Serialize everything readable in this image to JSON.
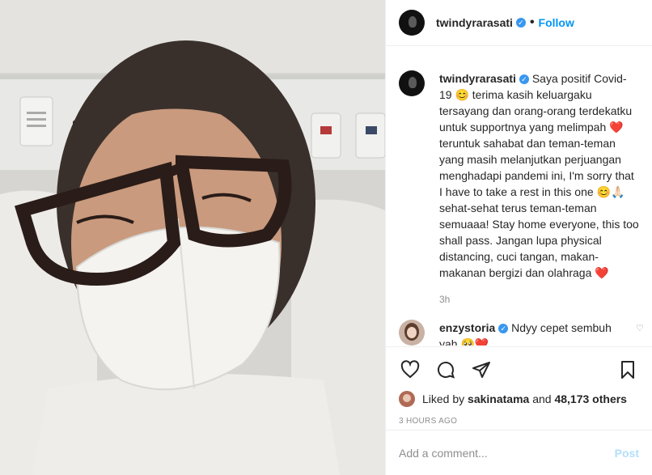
{
  "post": {
    "username": "twindyrarasati",
    "follow_label": "Follow",
    "separator": "•"
  },
  "caption": {
    "username": "twindyrarasati",
    "text": "Saya positif Covid-19 😊 terima kasih keluargaku tersayang dan orang-orang terdekatku untuk supportnya yang melimpah ❤️ teruntuk sahabat dan teman-teman yang masih melanjutkan perjuangan menghadapi pandemi ini, I'm sorry that I have to take a rest in this one 😊🙏🏻 sehat-sehat terus teman-teman semuaaa! Stay home everyone, this too shall pass. Jangan lupa physical distancing, cuci tangan, makan-makanan bergizi dan olahraga ❤️",
    "time": "3h"
  },
  "comment": {
    "username": "enzystoria",
    "text": "Ndyy cepet sembuh yah 🥺❤️"
  },
  "likes": {
    "prefix": "Liked by",
    "user": "sakinatama",
    "and": "and",
    "count": "48,173 others"
  },
  "posted_ago": "3 HOURS AGO",
  "add_comment": {
    "placeholder": "Add a comment...",
    "post_label": "Post"
  },
  "colors": {
    "link": "#0095f6",
    "verified": "#3897f0",
    "muted": "#8e8e8e"
  },
  "icons": [
    "heart-icon",
    "comment-icon",
    "share-icon",
    "bookmark-icon",
    "verified-icon"
  ]
}
